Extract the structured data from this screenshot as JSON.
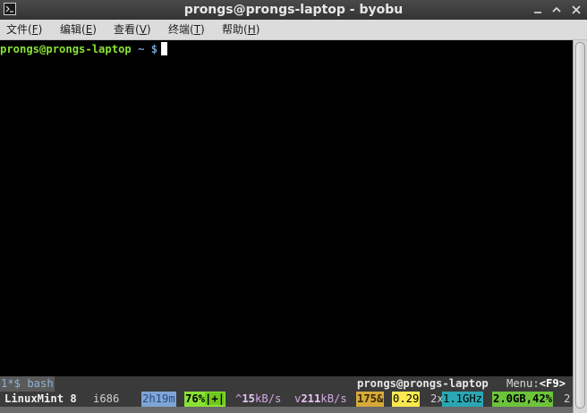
{
  "window": {
    "title": "prongs@prongs-laptop - byobu"
  },
  "menu": {
    "items": [
      {
        "label": "文件(",
        "accel": "F",
        "suffix": ")"
      },
      {
        "label": "编辑(",
        "accel": "E",
        "suffix": ")"
      },
      {
        "label": "查看(",
        "accel": "V",
        "suffix": ")"
      },
      {
        "label": "终端(",
        "accel": "T",
        "suffix": ")"
      },
      {
        "label": "帮助(",
        "accel": "H",
        "suffix": ")"
      }
    ]
  },
  "terminal": {
    "prompt_user": "prongs@prongs-laptop",
    "prompt_path": " ~ $"
  },
  "byobu": {
    "window_tab": "1*$ bash",
    "hostname": "prongs@prongs-laptop",
    "menu_label": "Menu:",
    "menu_key": "<F9>",
    "os": "LinuxMint 8",
    "arch": "i686",
    "uptime": "2h19m",
    "battery": "76%",
    "battery_state": "|+|",
    "net_up_prefix": "^",
    "net_up_value": "15",
    "net_up_unit": "kB/s",
    "net_down_prefix": "v",
    "net_down_value": "211",
    "net_down_unit": "kB/s",
    "processes": "175&",
    "load": "0.29",
    "cpu_count": "2x",
    "cpu_freq": "1.1GHz",
    "memory": "2.0GB,42%",
    "more": "2"
  },
  "colors": {
    "prompt_user": "#8ae234",
    "prompt_path": "#729fcf",
    "battery_bg": "#8ae234",
    "load_bg": "#fce94f",
    "freq_bg": "#2aa7b3"
  },
  "icons": [
    "terminal-icon",
    "minimize-icon",
    "maximize-icon",
    "close-icon"
  ]
}
